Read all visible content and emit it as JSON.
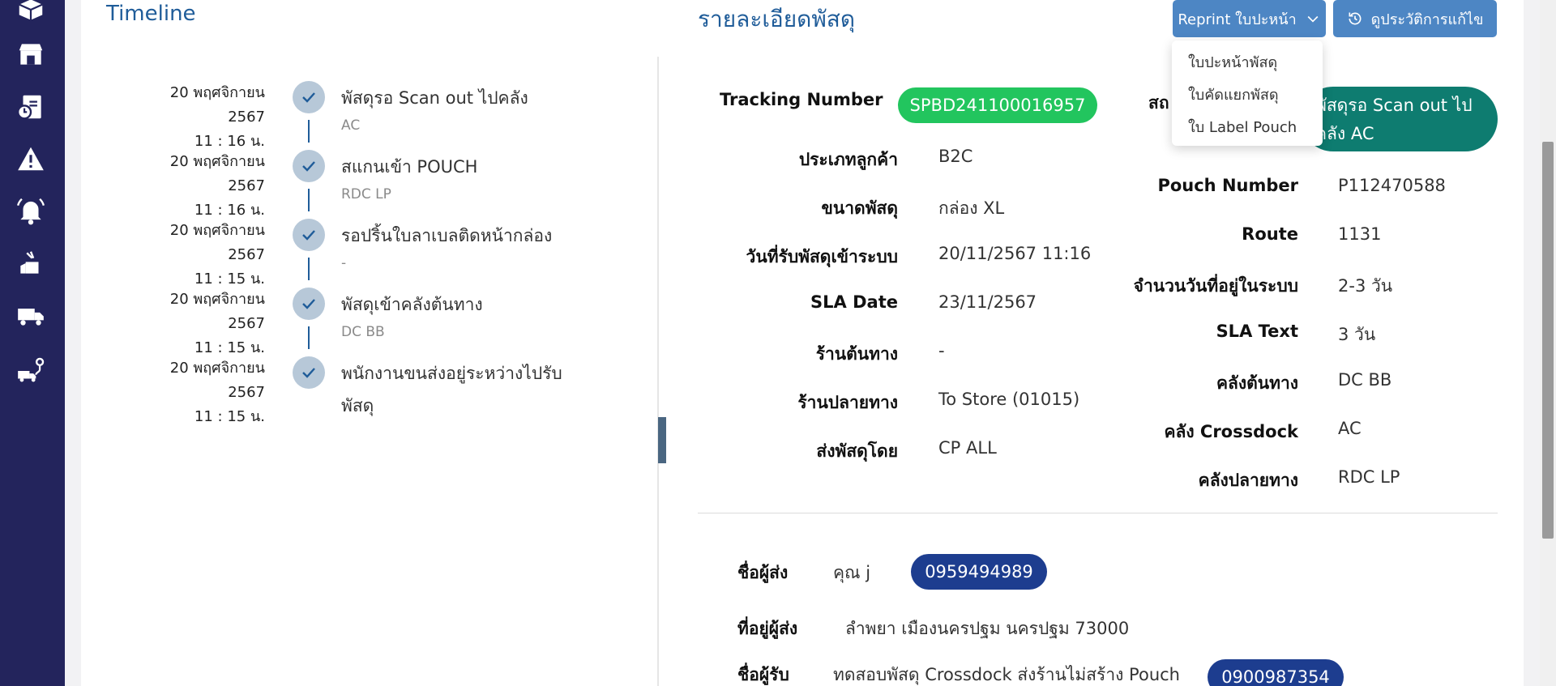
{
  "sidebar": {
    "icons": [
      "parcel-box-icon",
      "store-icon",
      "report-clock-icon",
      "warning-icon",
      "bell-icon",
      "parcel-hand-icon",
      "truck-icon",
      "route-truck-icon"
    ]
  },
  "timeline": {
    "title": "Timeline",
    "events": [
      {
        "date": "20 พฤศจิกายน",
        "year": "2567",
        "time": "11 : 16 น.",
        "status": "พัสดุรอ Scan out ไปคลัง",
        "location": "AC"
      },
      {
        "date": "20 พฤศจิกายน",
        "year": "2567",
        "time": "11 : 16 น.",
        "status": "สแกนเข้า POUCH",
        "location": "RDC LP"
      },
      {
        "date": "20 พฤศจิกายน",
        "year": "2567",
        "time": "11 : 15 น.",
        "status": "รอปริ้นใบลาเบลติดหน้ากล่อง",
        "location": "-"
      },
      {
        "date": "20 พฤศจิกายน",
        "year": "2567",
        "time": "11 : 15 น.",
        "status": "พัสดุเข้าคลังต้นทาง",
        "location": "DC BB"
      },
      {
        "date": "20 พฤศจิกายน",
        "year": "2567",
        "time": "11 : 15 น.",
        "status": "พนักงานขนส่งอยู่ระหว่างไปรับ",
        "status2": "พัสดุ"
      }
    ]
  },
  "details": {
    "title": "รายละเอียดพัสดุ",
    "reprint_button": "Reprint ใบปะหน้า",
    "history_button": "ดูประวัติการแก้ไข",
    "dropdown": [
      "ใบปะหน้าพัสดุ",
      "ใบคัดแยกพัสดุ",
      "ใบ Label Pouch"
    ],
    "tracking_label": "Tracking Number",
    "tracking_value": "SPBD241100016957",
    "status_label_partial": "สถ",
    "status_value": "พัสดุรอ Scan out ไปคลัง AC",
    "left_fields": [
      {
        "label": "ประเภทลูกค้า",
        "value": "B2C"
      },
      {
        "label": "ขนาดพัสดุ",
        "value": "กล่อง XL"
      },
      {
        "label": "วันที่รับพัสดุเข้าระบบ",
        "value": "20/11/2567 11:16"
      },
      {
        "label": "SLA Date",
        "value": "23/11/2567"
      },
      {
        "label": "ร้านต้นทาง",
        "value": "-"
      },
      {
        "label": "ร้านปลายทาง",
        "value": "To Store (01015)"
      },
      {
        "label": "ส่งพัสดุโดย",
        "value": "CP ALL"
      }
    ],
    "right_fields": [
      {
        "label": "Pouch Number",
        "value": "P112470588"
      },
      {
        "label": "Route",
        "value": "1131"
      },
      {
        "label": "จำนวนวันที่อยู่ในระบบ",
        "value": "2-3 วัน"
      },
      {
        "label": "SLA Text",
        "value": "3 วัน"
      },
      {
        "label": "คลังต้นทาง",
        "value": "DC BB"
      },
      {
        "label": "คลัง Crossdock",
        "value": "AC"
      },
      {
        "label": "คลังปลายทาง",
        "value": "RDC LP"
      }
    ],
    "sender_name_label": "ชื่อผู้ส่ง",
    "sender_name": "คุณ j",
    "sender_phone": "0959494989",
    "sender_address_label": "ที่อยู่ผู้ส่ง",
    "sender_address": "ลำพยา เมืองนครปฐม นครปฐม 73000",
    "receiver_name_label": "ชื่อผู้รับ",
    "receiver_name": "ทดสอบพัสดุ Crossdock ส่งร้านไม่สร้าง Pouch",
    "receiver_phone": "0900987354"
  },
  "colors": {
    "sidebar": "#23245c",
    "accent_blue": "#1f5c99",
    "button_blue": "#4d86c4",
    "tracking_green": "#22c55e",
    "status_teal": "#0e7c70",
    "phone_navy": "#1d3d8f"
  }
}
